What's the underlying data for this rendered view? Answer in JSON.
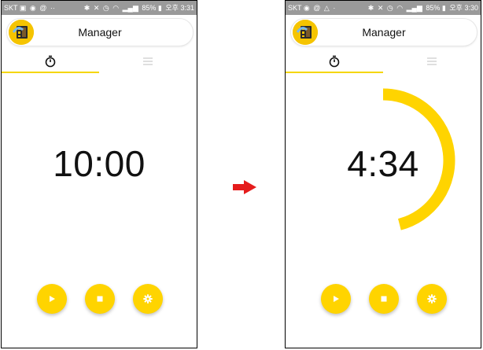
{
  "screens": [
    {
      "status": {
        "carrier": "SKT",
        "battery": "85%",
        "ampm": "오후",
        "time": "3:31"
      },
      "app_title": "Manager",
      "timer": {
        "display": "10:00",
        "progress": 0
      },
      "tabs": [
        "stopwatch-icon",
        "list-icon"
      ]
    },
    {
      "status": {
        "carrier": "SKT",
        "battery": "85%",
        "ampm": "오후",
        "time": "3:30"
      },
      "app_title": "Manager",
      "timer": {
        "display": "4:34",
        "progress": 0.46
      },
      "tabs": [
        "stopwatch-icon",
        "list-icon"
      ]
    }
  ],
  "colors": {
    "accent": "#FFD400",
    "tab_indicator": "#F5D600",
    "arrow": "#E51C1C",
    "statusbar": "#9A9A9A"
  },
  "icons": [
    "play-icon",
    "stop-icon",
    "settings-icon",
    "right-arrow-icon"
  ]
}
